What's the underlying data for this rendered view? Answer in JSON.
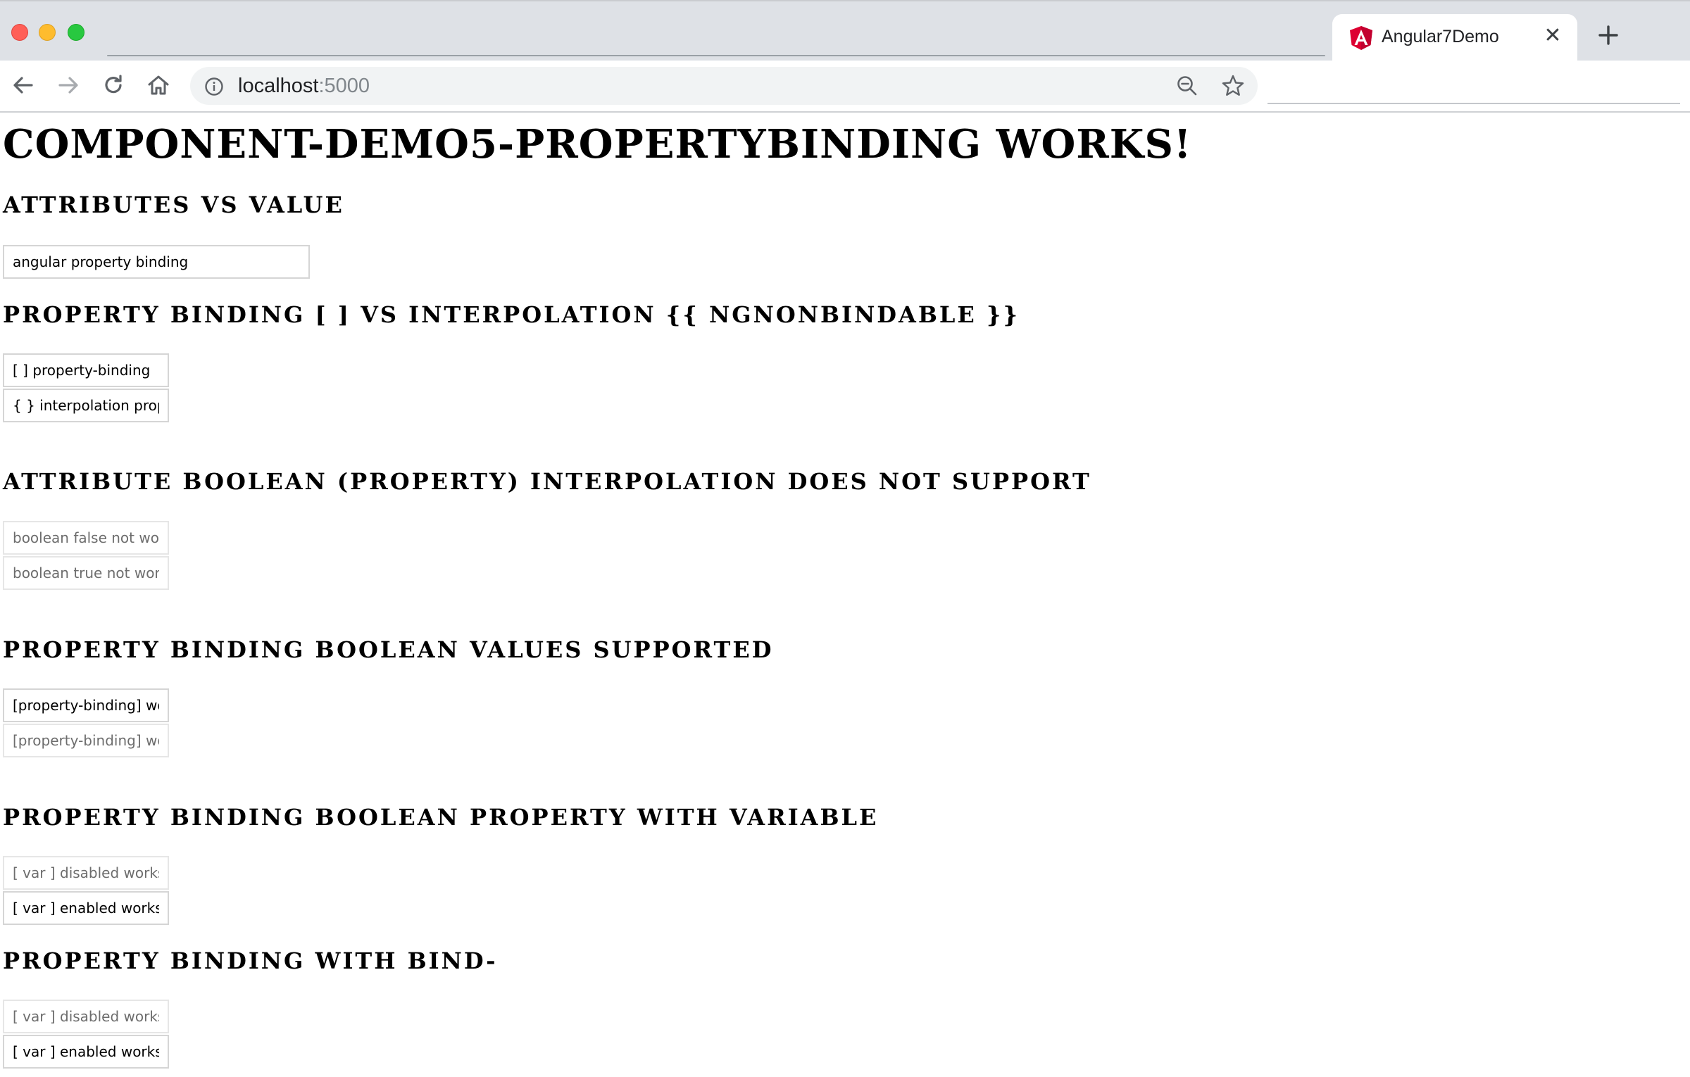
{
  "browser": {
    "tab_title": "Angular7Demo",
    "url_host": "localhost",
    "url_port": ":5000"
  },
  "page": {
    "title": "component-demo5-propertybinding works!",
    "sections": [
      {
        "heading": "Attributes vs Value",
        "inputs": [
          {
            "value": "angular property binding",
            "disabled": false
          }
        ]
      },
      {
        "heading": "Property binding [ ] vs interpolation {{ ngNonBindable }}",
        "inputs": [
          {
            "value": "[ ] property-binding",
            "disabled": false
          },
          {
            "value": "{ } interpolation property",
            "disabled": false
          }
        ]
      },
      {
        "heading": "Attribute boolean (property) interpolation does not support",
        "inputs": [
          {
            "value": "boolean false not work",
            "disabled": true
          },
          {
            "value": "boolean true not work",
            "disabled": true
          }
        ]
      },
      {
        "heading": "Property binding boolean values supported",
        "inputs": [
          {
            "value": "[property-binding] works",
            "disabled": false
          },
          {
            "value": "[property-binding] works",
            "disabled": true
          }
        ]
      },
      {
        "heading": "Property binding boolean property with variable",
        "inputs": [
          {
            "value": "[ var ] disabled works",
            "disabled": true
          },
          {
            "value": "[ var ] enabled works",
            "disabled": false
          }
        ]
      },
      {
        "heading": "Property binding with bind-",
        "inputs": [
          {
            "value": "[ var ] disabled works",
            "disabled": true
          },
          {
            "value": "[ var ] enabled works",
            "disabled": false
          }
        ]
      }
    ]
  }
}
